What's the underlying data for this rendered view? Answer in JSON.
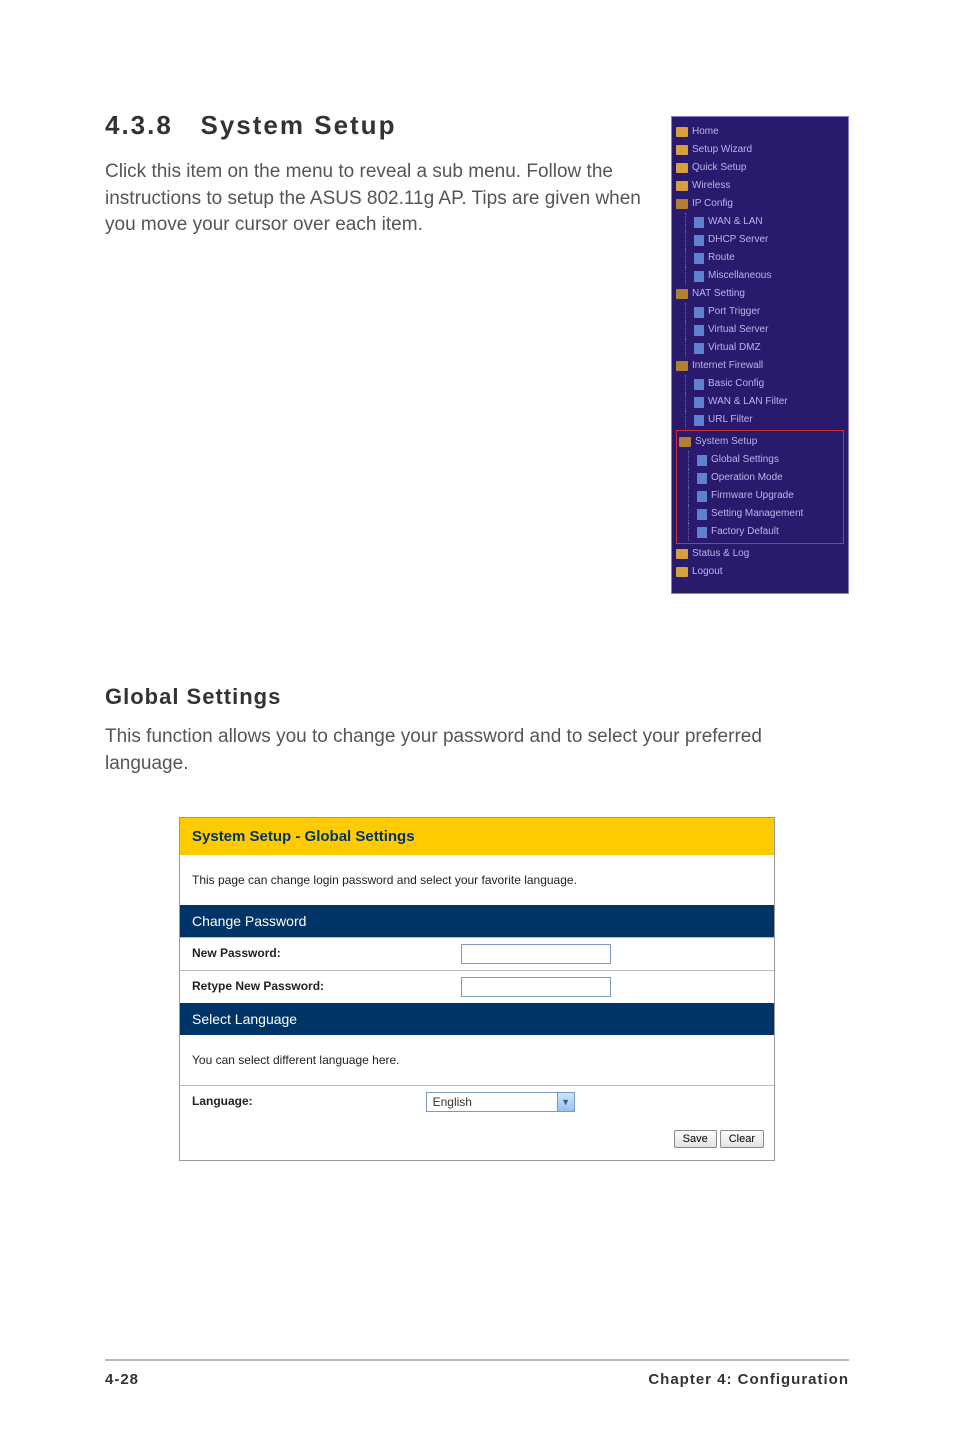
{
  "heading": {
    "number": "4.3.8",
    "title": "System Setup",
    "intro": "Click this item on the menu to reveal a sub menu. Follow the instructions to setup the ASUS 802.11g AP. Tips are given when you move your cursor over each item."
  },
  "nav": {
    "items": [
      {
        "type": "folder",
        "label": "Home",
        "indent": 0
      },
      {
        "type": "folder",
        "label": "Setup Wizard",
        "indent": 0
      },
      {
        "type": "folder",
        "label": "Quick Setup",
        "indent": 0
      },
      {
        "type": "folder",
        "label": "Wireless",
        "indent": 0
      },
      {
        "type": "folder-open",
        "label": "IP Config",
        "indent": 0
      },
      {
        "type": "doc",
        "label": "WAN & LAN",
        "indent": 1
      },
      {
        "type": "doc",
        "label": "DHCP Server",
        "indent": 1
      },
      {
        "type": "doc",
        "label": "Route",
        "indent": 1
      },
      {
        "type": "doc",
        "label": "Miscellaneous",
        "indent": 1
      },
      {
        "type": "folder-open",
        "label": "NAT Setting",
        "indent": 0
      },
      {
        "type": "doc",
        "label": "Port Trigger",
        "indent": 1
      },
      {
        "type": "doc",
        "label": "Virtual Server",
        "indent": 1
      },
      {
        "type": "doc",
        "label": "Virtual DMZ",
        "indent": 1
      },
      {
        "type": "folder-open",
        "label": "Internet Firewall",
        "indent": 0
      },
      {
        "type": "doc",
        "label": "Basic Config",
        "indent": 1
      },
      {
        "type": "doc",
        "label": "WAN & LAN Filter",
        "indent": 1
      },
      {
        "type": "doc",
        "label": "URL Filter",
        "indent": 1
      }
    ],
    "highlighted": [
      {
        "type": "folder-open",
        "label": "System Setup",
        "indent": 0
      },
      {
        "type": "doc",
        "label": "Global Settings",
        "indent": 1
      },
      {
        "type": "doc",
        "label": "Operation Mode",
        "indent": 1
      },
      {
        "type": "doc",
        "label": "Firmware Upgrade",
        "indent": 1
      },
      {
        "type": "doc",
        "label": "Setting Management",
        "indent": 1
      },
      {
        "type": "doc",
        "label": "Factory Default",
        "indent": 1
      }
    ],
    "after": [
      {
        "type": "folder",
        "label": "Status & Log",
        "indent": 0
      },
      {
        "type": "folder",
        "label": "Logout",
        "indent": 0
      }
    ]
  },
  "subsection": {
    "title": "Global Settings",
    "desc": "This function allows you to change your password and to select your preferred language."
  },
  "settings": {
    "title": "System Setup - Global Settings",
    "desc": "This page can change login password and select your favorite language.",
    "change_password_header": "Change Password",
    "new_password_label": "New Password:",
    "retype_password_label": "Retype New Password:",
    "select_language_header": "Select Language",
    "select_language_desc": "You can select different language here.",
    "language_label": "Language:",
    "language_value": "English",
    "save_label": "Save",
    "clear_label": "Clear"
  },
  "footer": {
    "page": "4-28",
    "chapter": "Chapter 4: Configuration"
  }
}
